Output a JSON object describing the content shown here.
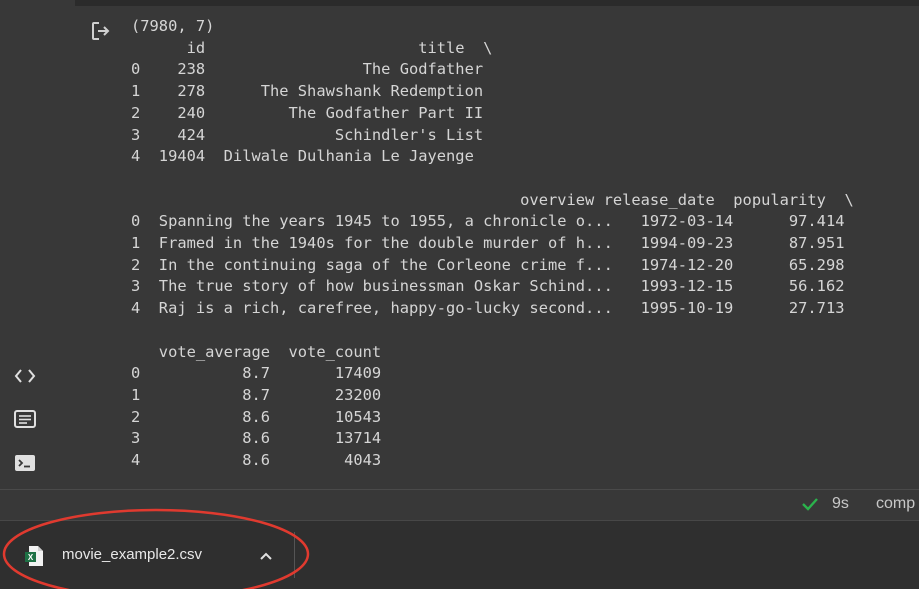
{
  "output": {
    "lines": [
      "(7980, 7)",
      "      id                       title  \\",
      "0    238                 The Godfather",
      "1    278      The Shawshank Redemption",
      "2    240         The Godfather Part II",
      "3    424              Schindler's List",
      "4  19404  Dilwale Dulhania Le Jayenge",
      "",
      "                                          overview release_date  popularity  \\",
      "0  Spanning the years 1945 to 1955, a chronicle o...   1972-03-14      97.414",
      "1  Framed in the 1940s for the double murder of h...   1994-09-23      87.951",
      "2  In the continuing saga of the Corleone crime f...   1974-12-20      65.298",
      "3  The true story of how businessman Oskar Schind...   1993-12-15      56.162",
      "4  Raj is a rich, carefree, happy-go-lucky second...   1995-10-19      27.713",
      "",
      "   vote_average  vote_count",
      "0           8.7       17409",
      "1           8.7       23200",
      "2           8.6       10543",
      "3           8.6       13714",
      "4           8.6        4043"
    ]
  },
  "status": {
    "elapsed": "9s",
    "text": "comp"
  },
  "downloads": {
    "file_name": "movie_example2.csv"
  },
  "colors": {
    "background": "#383838",
    "output_text": "#d5d5d5",
    "check_green": "#2bb24c",
    "annotation_red": "#e03a2f",
    "excel_green": "#1e7145"
  },
  "icons": {
    "output": "output-redirect-icon",
    "rail": [
      "code-icon",
      "text-snippet-icon",
      "terminal-icon"
    ],
    "status": "check-icon",
    "file": "excel-file-icon",
    "chevron": "chevron-up-icon"
  }
}
